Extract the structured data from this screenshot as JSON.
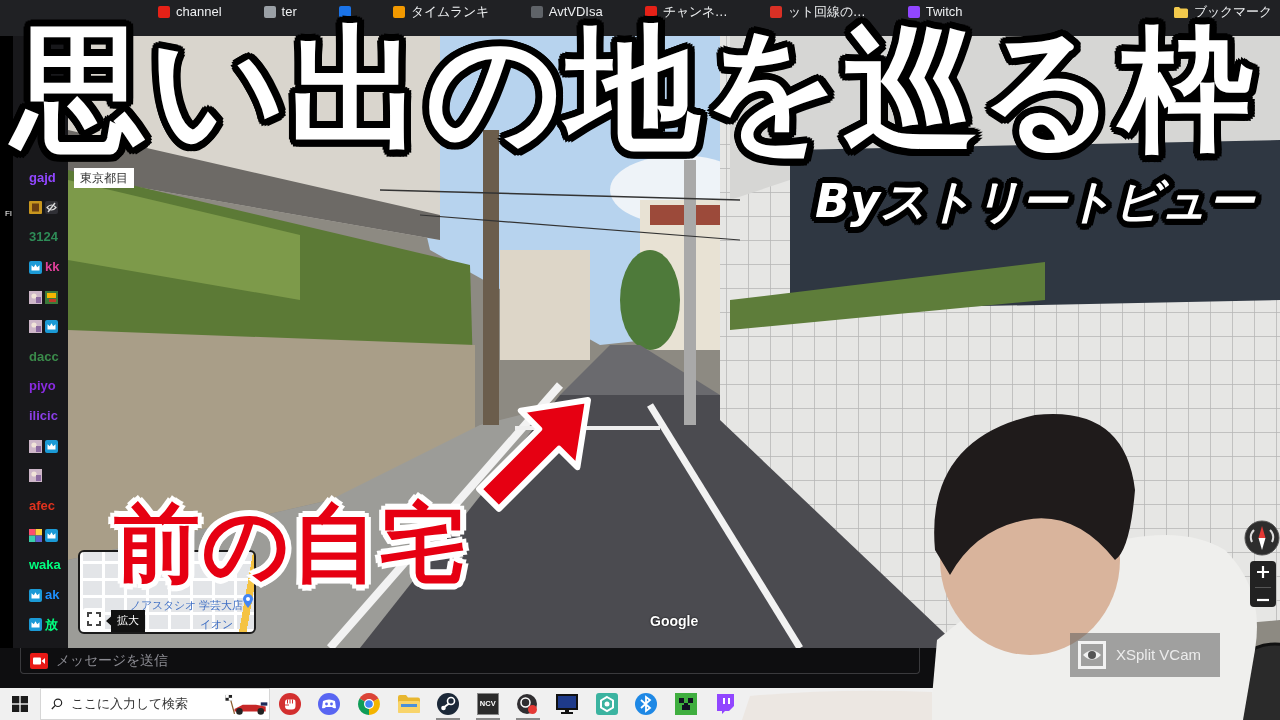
{
  "browser": {
    "bookmarks": [
      {
        "kind": "site",
        "label": "channel",
        "color": "#e62117"
      },
      {
        "kind": "site",
        "label": "ter",
        "color": "#9aa0a6"
      },
      {
        "kind": "site",
        "color": "#1a73e8"
      },
      {
        "kind": "site",
        "label": "タイムランキ",
        "color": "#f29900"
      },
      {
        "kind": "site",
        "label": "AvtVDIsa",
        "color": "#5f6368"
      },
      {
        "kind": "site",
        "label": "チャンネ…",
        "color": "#e62117"
      },
      {
        "kind": "site",
        "label": "ット回線の…",
        "color": "#d93025"
      },
      {
        "kind": "site",
        "label": "Twitch",
        "color": "#9146ff"
      },
      {
        "kind": "folder",
        "label": "ブックマーク",
        "color": "#f2c94c"
      }
    ]
  },
  "strip": {
    "label": "Fl"
  },
  "chat": {
    "messages": [
      {
        "name": "gajd",
        "color": "#9147ff"
      },
      {
        "badges": [
          {
            "kind": "gold"
          },
          {
            "kind": "eye-off"
          }
        ]
      },
      {
        "name": "3124",
        "color": "#2e8b57"
      },
      {
        "badges": [
          {
            "kind": "crown"
          }
        ],
        "name": "kk",
        "color": "#e0409a"
      },
      {
        "badges": [
          {
            "kind": "emote"
          },
          {
            "kind": "versus"
          }
        ]
      },
      {
        "badges": [
          {
            "kind": "emote"
          },
          {
            "kind": "crown"
          }
        ]
      },
      {
        "name": "dacc",
        "color": "#3a8a4a"
      },
      {
        "name": "piyo",
        "color": "#8a2be2"
      },
      {
        "name": "ilicic",
        "color": "#8a3ee6"
      },
      {
        "badges": [
          {
            "kind": "emote"
          },
          {
            "kind": "crown"
          }
        ]
      },
      {
        "badges": [
          {
            "kind": "emote"
          }
        ]
      },
      {
        "name": "afec",
        "color": "#e0321e"
      },
      {
        "badges": [
          {
            "kind": "rainbow"
          },
          {
            "kind": "crown"
          }
        ]
      },
      {
        "name": "waka",
        "color": "#00ff7f"
      },
      {
        "badges": [
          {
            "kind": "crown"
          }
        ],
        "name": "ak",
        "color": "#1e90ff"
      },
      {
        "badges": [
          {
            "kind": "crown"
          }
        ],
        "name": "放",
        "color": "#00ff7f"
      }
    ],
    "input": {
      "placeholder": "メッセージを送信"
    }
  },
  "street_view": {
    "address": "東京都目",
    "minimap": {
      "places": [
        "ノアスタシオ 学芸大店",
        "イオン"
      ],
      "tooltip": "拡大"
    },
    "attribution": "Google"
  },
  "overlay": {
    "title": "思い出の地を巡る枠",
    "subtitle": "Byストリートビュー",
    "caption": "前の自宅"
  },
  "webcam": {
    "watermark": "XSplit VCam"
  },
  "taskbar": {
    "search": {
      "placeholder": "ここに入力して検索"
    },
    "apps": [
      {
        "kind": "fist",
        "running": false
      },
      {
        "kind": "controller",
        "running": false
      },
      {
        "kind": "wheel",
        "running": false
      },
      {
        "kind": "folder",
        "running": false
      },
      {
        "kind": "piston",
        "running": true
      },
      {
        "kind": "tile",
        "label": "NCV",
        "running": true
      },
      {
        "kind": "record",
        "running": true
      },
      {
        "kind": "monitor",
        "running": false
      },
      {
        "kind": "ring",
        "running": false
      },
      {
        "kind": "rune",
        "running": false
      },
      {
        "kind": "pixelface",
        "running": false
      },
      {
        "kind": "bubble",
        "running": false
      }
    ]
  }
}
